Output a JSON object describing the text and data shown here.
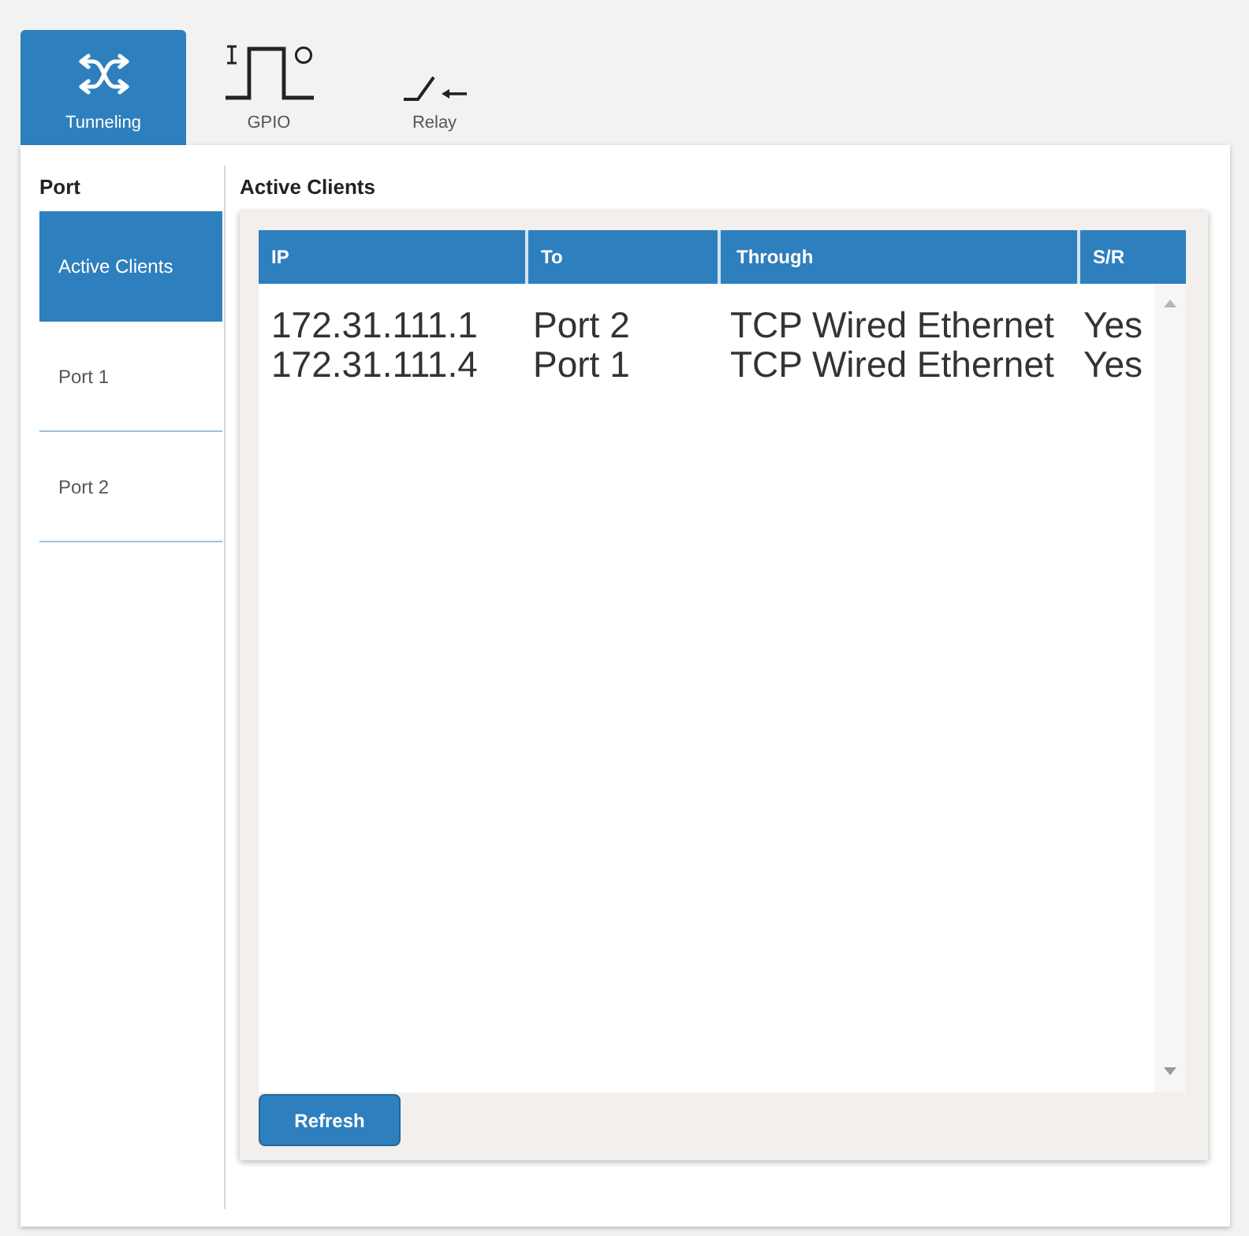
{
  "tabs": [
    {
      "label": "Tunneling",
      "kind": "tunneling",
      "selected": true
    },
    {
      "label": "GPIO",
      "kind": "gpio",
      "selected": false
    },
    {
      "label": "Relay",
      "kind": "relay",
      "selected": false
    }
  ],
  "sidebar": {
    "title": "Port",
    "items": [
      {
        "label": "Active Clients",
        "selected": true
      },
      {
        "label": "Port 1",
        "selected": false
      },
      {
        "label": "Port 2",
        "selected": false
      }
    ]
  },
  "content": {
    "title": "Active Clients",
    "table": {
      "columns": [
        "IP",
        "To",
        "Through",
        "S/R"
      ],
      "rows": [
        [
          "172.31.111.1",
          "Port 2",
          "TCP Wired Ethernet",
          "Yes"
        ],
        [
          "172.31.111.4",
          "Port 1",
          "TCP Wired Ethernet",
          "Yes"
        ]
      ]
    },
    "button": {
      "label": "Refresh"
    }
  }
}
